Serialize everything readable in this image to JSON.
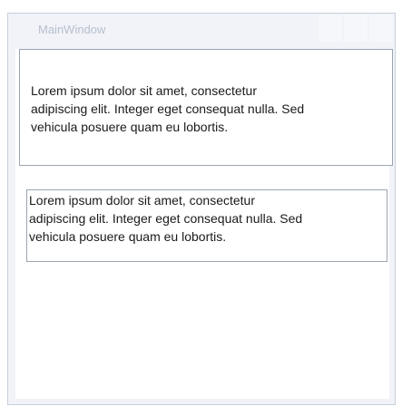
{
  "window": {
    "title": "MainWindow"
  },
  "blocks": [
    {
      "lines": [
        "Lorem ipsum dolor sit amet, consectetur",
        "adipiscing elit. Integer eget consequat nulla. Sed",
        "vehicula posuere quam eu lobortis."
      ]
    },
    {
      "lines": [
        "Lorem ipsum dolor sit amet, consectetur",
        "adipiscing elit. Integer eget consequat nulla. Sed",
        "vehicula posuere quam eu lobortis."
      ]
    }
  ]
}
